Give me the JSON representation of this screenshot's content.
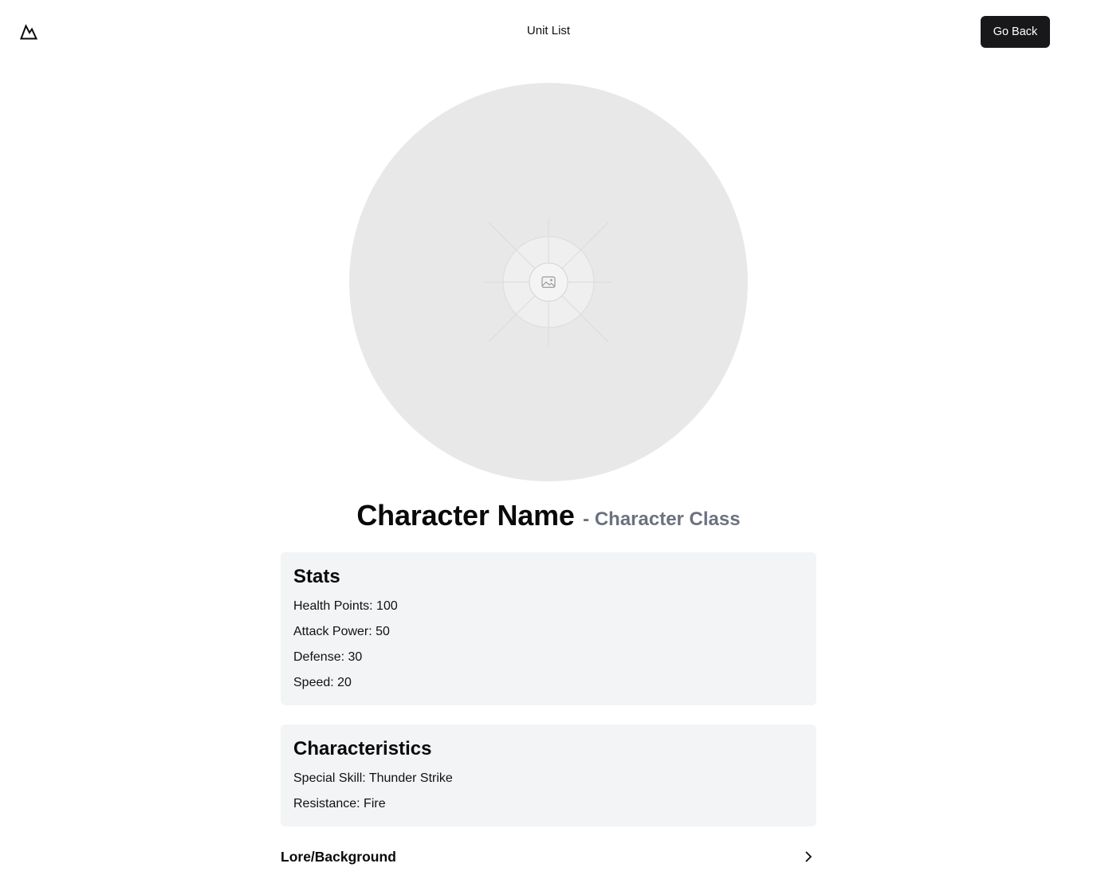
{
  "header": {
    "logo_icon": "mountain-logo-icon",
    "nav_title": "Unit List",
    "go_back_label": "Go Back"
  },
  "avatar": {
    "icon": "image-placeholder-icon"
  },
  "character": {
    "name": "Character Name",
    "class_label": "- Character Class"
  },
  "stats": {
    "heading": "Stats",
    "items": [
      "Health Points: 100",
      "Attack Power: 50",
      "Defense: 30",
      "Speed: 20"
    ]
  },
  "characteristics": {
    "heading": "Characteristics",
    "items": [
      "Special Skill: Thunder Strike",
      "Resistance: Fire"
    ]
  },
  "lore": {
    "label": "Lore/Background",
    "icon": "chevron-right-icon"
  },
  "colors": {
    "button_bg": "#18181b",
    "card_bg": "#f3f4f6",
    "class_text": "#6b7280",
    "avatar_bg": "#e8e8e8"
  }
}
